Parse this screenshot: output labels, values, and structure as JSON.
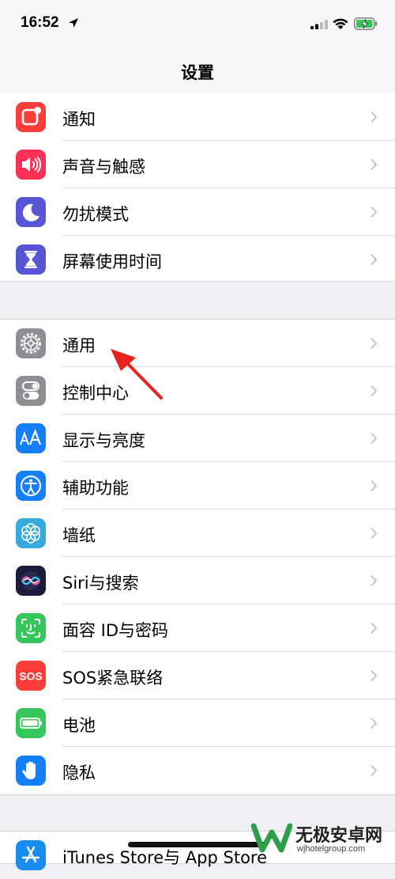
{
  "status_bar": {
    "time": "16:52",
    "signal_icon": "cellular-signal-icon",
    "wifi_icon": "wifi-icon",
    "battery_icon": "battery-charging-icon"
  },
  "nav": {
    "title": "设置"
  },
  "groups": [
    {
      "items": [
        {
          "label": "通知",
          "icon": "notifications-icon",
          "color": "#fc3d39"
        },
        {
          "label": "声音与触感",
          "icon": "sounds-icon",
          "color": "#fc3158"
        },
        {
          "label": "勿扰模式",
          "icon": "moon-icon",
          "color": "#5856d6"
        },
        {
          "label": "屏幕使用时间",
          "icon": "hourglass-icon",
          "color": "#5856d6"
        }
      ]
    },
    {
      "items": [
        {
          "label": "通用",
          "icon": "gear-icon",
          "color": "#8e8e93"
        },
        {
          "label": "控制中心",
          "icon": "toggles-icon",
          "color": "#8e8e93"
        },
        {
          "label": "显示与亮度",
          "icon": "display-aa-icon",
          "color": "#147efb"
        },
        {
          "label": "辅助功能",
          "icon": "accessibility-icon",
          "color": "#147efb"
        },
        {
          "label": "墙纸",
          "icon": "wallpaper-flower-icon",
          "color": "#36aadc"
        },
        {
          "label": "Siri与搜索",
          "icon": "siri-icon",
          "color": "#1c1c3a"
        },
        {
          "label": "面容 ID与密码",
          "icon": "face-id-icon",
          "color": "#34c759"
        },
        {
          "label": "SOS紧急联络",
          "icon": "sos-icon",
          "color": "#fc3d39"
        },
        {
          "label": "电池",
          "icon": "battery-icon",
          "color": "#34c759"
        },
        {
          "label": "隐私",
          "icon": "hand-icon",
          "color": "#147efb"
        }
      ]
    },
    {
      "items": [
        {
          "label": "iTunes Store与 App Store",
          "icon": "app-store-icon",
          "color": "#1a8cf0"
        }
      ]
    }
  ],
  "annotation": {
    "arrow_color": "#e8231d"
  },
  "watermark": {
    "name": "无极安卓网",
    "url": "wjhotelgroup.com"
  }
}
